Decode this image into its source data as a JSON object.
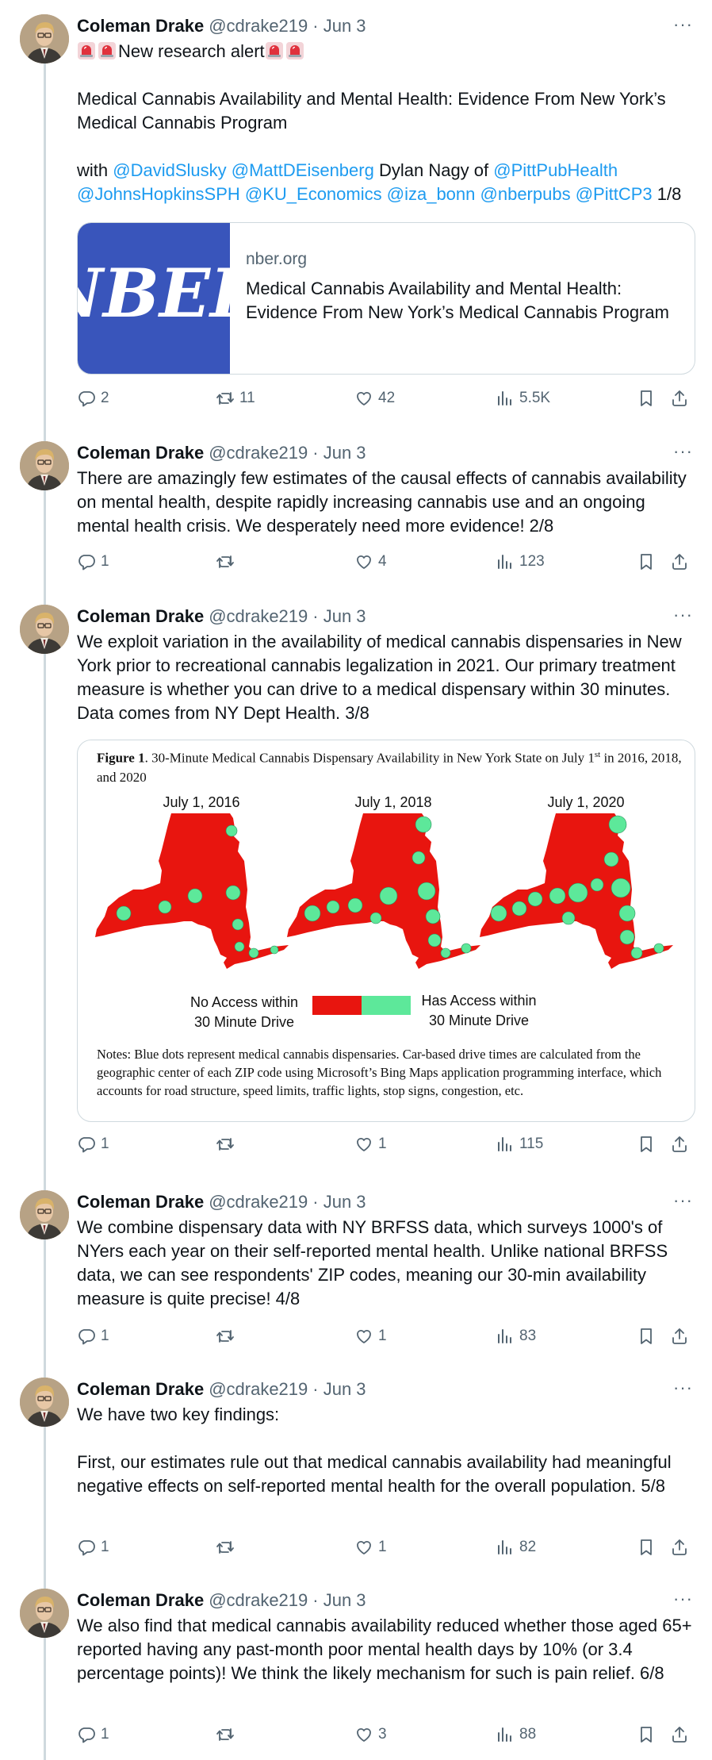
{
  "author": {
    "name": "Coleman Drake",
    "handle": "@cdrake219",
    "date": "· Jun 3"
  },
  "more_label": "···",
  "tweets": [
    {
      "p1": {
        "text": "New research alert"
      },
      "p2": "Medical Cannabis Availability and Mental Health: Evidence From New York’s Medical Cannabis Program",
      "p3": {
        "with": "with",
        "m1": "@DavidSlusky",
        "m2": "@MattDEisenberg",
        "plain1": "Dylan Nagy of",
        "m3": "@PittPubHealth",
        "m4": "@JohnsHopkinsSPH",
        "m5": "@KU_Economics",
        "m6": "@iza_bonn",
        "m7": "@nberpubs",
        "m8": "@PittCP3",
        "tail": "1/8"
      },
      "card": {
        "logo": "NBER",
        "domain": "nber.org",
        "title": "Medical Cannabis Availability and Mental Health: Evidence From New York’s Medical Cannabis Program"
      },
      "stats": {
        "replies": "2",
        "retweets": "11",
        "likes": "42",
        "views": "5.5K"
      }
    },
    {
      "text": "There are amazingly few estimates of the causal effects of cannabis availability on mental health, despite rapidly increasing cannabis use and an ongoing mental health crisis. We desperately need more evidence! 2/8",
      "stats": {
        "replies": "1",
        "retweets": "",
        "likes": "4",
        "views": "123"
      }
    },
    {
      "text": "We exploit variation in the availability of medical cannabis dispensaries in New York prior to recreational cannabis legalization in 2021. Our primary treatment measure is whether you can drive to a medical dispensary within 30 minutes. Data comes from NY Dept Health. 3/8",
      "figure": {
        "fig_num": "Figure 1",
        "caption_before_sup": ". 30-Minute Medical Cannabis Dispensary Availability in New York State on July 1",
        "sup": "st",
        "caption_after_sup": " in 2016, 2018, and 2020",
        "maps": [
          "July 1, 2016",
          "July 1, 2018",
          "July 1, 2020"
        ],
        "legend_no": [
          "No Access within",
          "30 Minute Drive"
        ],
        "legend_yes": [
          "Has Access within",
          "30 Minute Drive"
        ],
        "colors": {
          "no_access": "#e8150f",
          "has_access": "#5de89a"
        },
        "notes": "Notes: Blue dots represent medical cannabis dispensaries. Car-based drive times are calculated from the geographic center of each ZIP code using Microsoft’s Bing Maps application programming interface, which accounts for road structure, speed limits, traffic lights, stop signs, congestion, etc."
      },
      "stats": {
        "replies": "1",
        "retweets": "",
        "likes": "1",
        "views": "115"
      }
    },
    {
      "text": "We combine dispensary data with NY BRFSS data, which surveys 1000's of NYers each year on their self-reported mental health. Unlike national BRFSS data, we can see respondents' ZIP codes, meaning our 30-min availability measure is quite precise! 4/8",
      "stats": {
        "replies": "1",
        "retweets": "",
        "likes": "1",
        "views": "83"
      }
    },
    {
      "p1": "We have two key findings:",
      "p2": "First, our estimates rule out that medical cannabis availability had meaningful negative effects on self-reported mental health for the overall population. 5/8",
      "stats": {
        "replies": "1",
        "retweets": "",
        "likes": "1",
        "views": "82"
      }
    },
    {
      "text": "We also find that medical cannabis availability reduced whether those aged 65+ reported having any past-month poor mental health days by 10% (or 3.4 percentage points)! We think the likely mechanism for such is pain relief. 6/8",
      "stats": {
        "replies": "1",
        "retweets": "",
        "likes": "3",
        "views": "88"
      }
    }
  ],
  "icons": [
    "reply-icon",
    "retweet-icon",
    "like-icon",
    "views-icon",
    "bookmark-icon",
    "share-icon",
    "siren-icon",
    "more-icon"
  ],
  "colors": {
    "link": "#1d9bf0",
    "muted": "#536471",
    "border": "#cfd9de",
    "nber_blue": "#3955bb"
  }
}
